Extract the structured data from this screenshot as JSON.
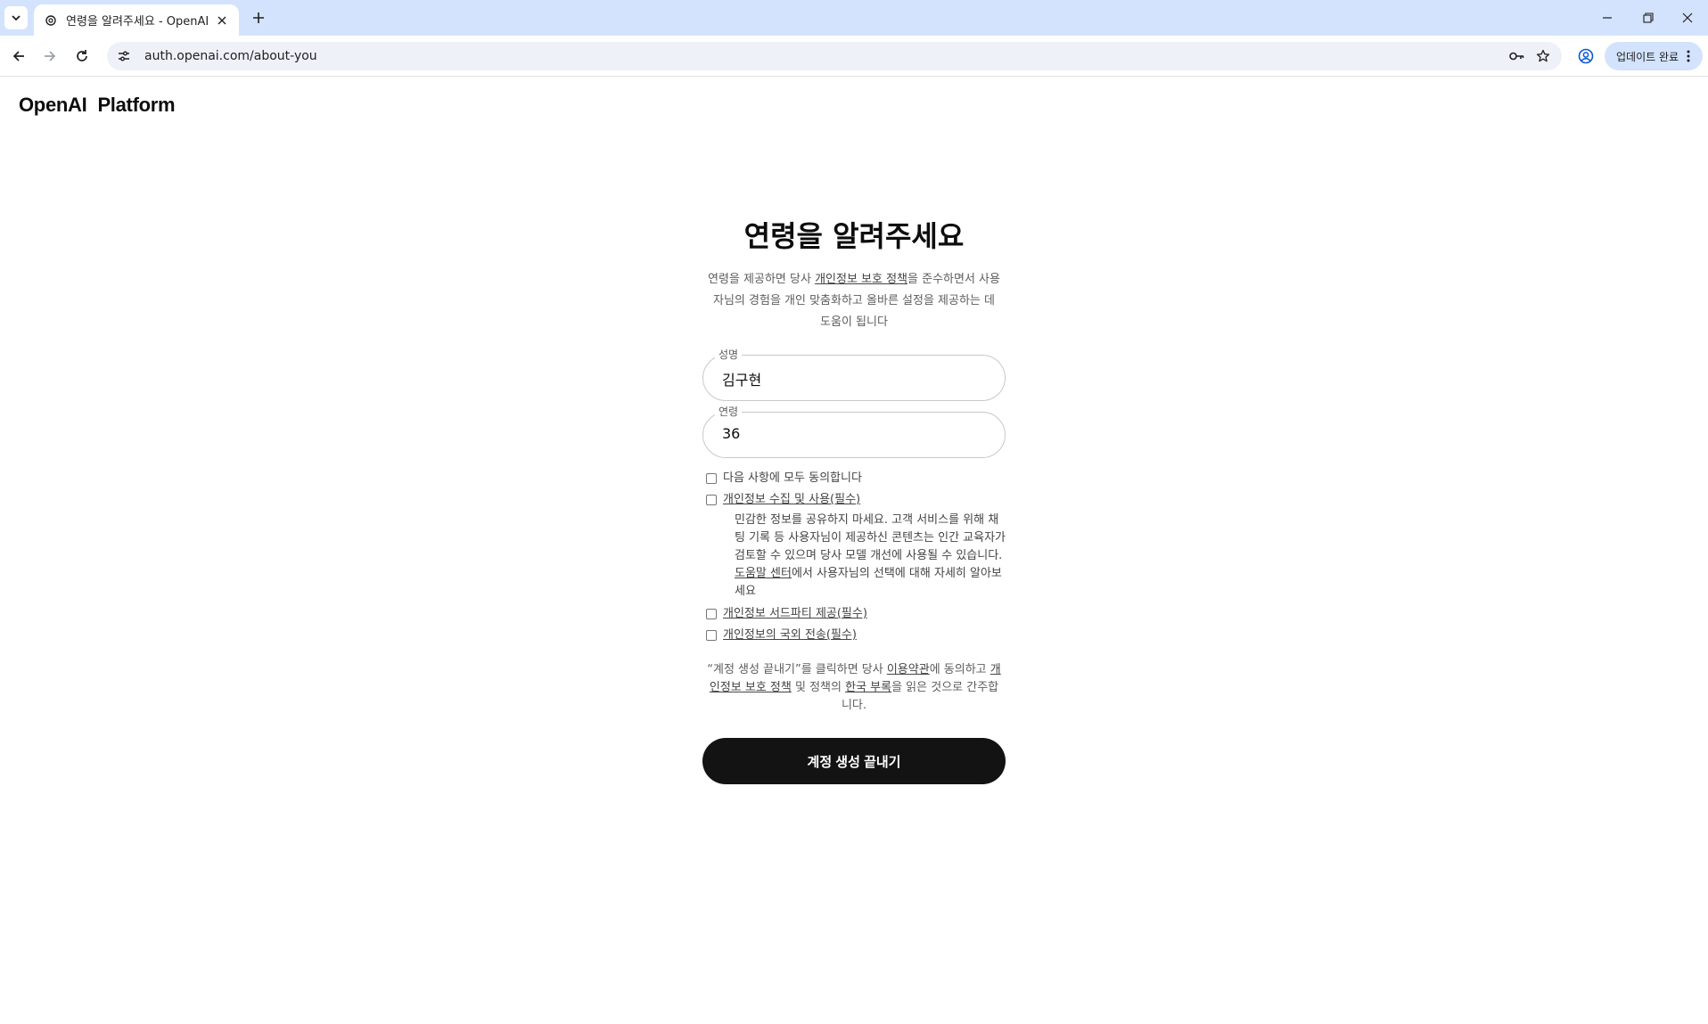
{
  "browser": {
    "tab_title": "연령을 알려주세요 - OpenAI",
    "url": "auth.openai.com/about-you",
    "update_label": "업데이트 완료"
  },
  "page": {
    "brand_openai": "OpenAI",
    "brand_platform": "Platform",
    "title": "연령을 알려주세요",
    "desc_part1": "연령을 제공하면 당사 ",
    "desc_link": "개인정보 보호 정책",
    "desc_part2": "을 준수하면서 사용자님의 경험을 개인 맞춤화하고 올바른 설정을 제공하는 데 도움이 됩니다",
    "name_label": "성명",
    "name_value": "김구현",
    "age_label": "연령",
    "age_value": "36",
    "check_all": "다음 사항에 모두 동의합니다",
    "check_collect": "개인정보 수집 및 사용(필수)",
    "collect_note_part1": "민감한 정보를 공유하지 마세요. 고객 서비스를 위해 채팅 기록 등 사용자님이 제공하신 콘텐츠는 인간 교육자가 검토할 수 있으며 당사 모델 개선에 사용될 수 있습니다. ",
    "collect_note_link": "도움말 센터",
    "collect_note_part2": "에서 사용자님의 선택에 대해 자세히 알아보세요",
    "check_third_party": "개인정보 서드파티 제공(필수)",
    "check_transfer": "개인정보의 국외 전송(필수)",
    "terms_part1": "“계정 생성 끝내기”를 클릭하면 당사 ",
    "terms_link1": "이용약관",
    "terms_part2": "에 동의하고 ",
    "terms_link2": "개인정보 보호 정책",
    "terms_part3": " 및 정책의 ",
    "terms_link3": "한국 부록",
    "terms_part4": "을 읽은 것으로 간주합니다.",
    "submit_label": "계정 생성 끝내기"
  },
  "icons": {
    "tab_list": "chevron-down-icon",
    "favicon": "openai-logo-icon",
    "close": "close-icon",
    "new_tab": "plus-icon",
    "back": "arrow-left-icon",
    "forward": "arrow-right-icon",
    "reload": "reload-icon",
    "site_info": "tune-icon",
    "password": "key-icon",
    "bookmark": "star-icon",
    "profile": "account-circle-icon",
    "menu": "more-vert-icon"
  }
}
